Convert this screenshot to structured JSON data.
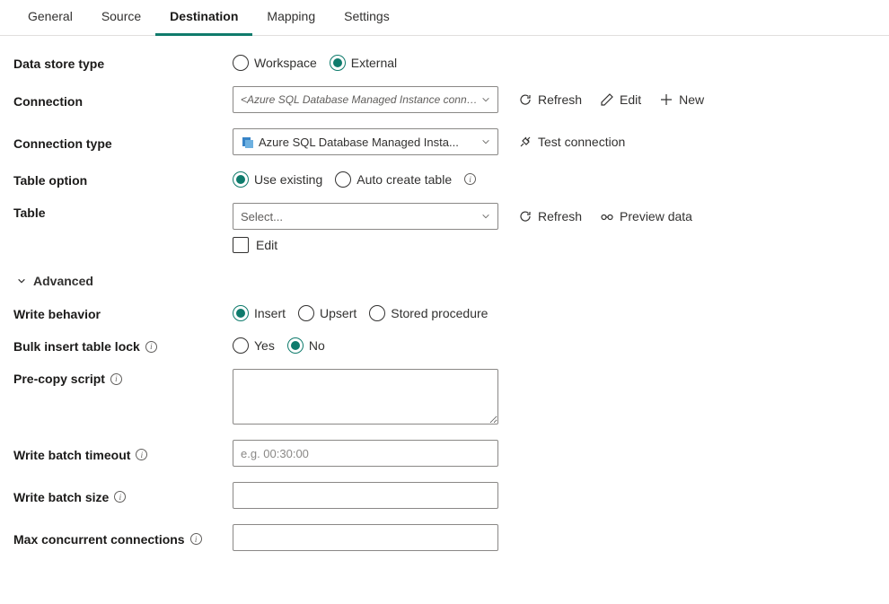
{
  "tabs": {
    "general": "General",
    "source": "Source",
    "destination": "Destination",
    "mapping": "Mapping",
    "settings": "Settings"
  },
  "labels": {
    "data_store_type": "Data store type",
    "connection": "Connection",
    "connection_type": "Connection type",
    "table_option": "Table option",
    "table": "Table",
    "advanced": "Advanced",
    "write_behavior": "Write behavior",
    "bulk_insert_table_lock": "Bulk insert table lock",
    "pre_copy_script": "Pre-copy script",
    "write_batch_timeout": "Write batch timeout",
    "write_batch_size": "Write batch size",
    "max_concurrent_connections": "Max concurrent connections"
  },
  "data_store_type": {
    "workspace": "Workspace",
    "external": "External",
    "selected": "external"
  },
  "connection": {
    "value": "<Azure SQL Database Managed Instance connection>",
    "refresh": "Refresh",
    "edit": "Edit",
    "new": "New"
  },
  "connection_type": {
    "value": "Azure SQL Database Managed Insta...",
    "test": "Test connection"
  },
  "table_option_opts": {
    "use_existing": "Use existing",
    "auto_create": "Auto create table",
    "selected": "use_existing"
  },
  "table": {
    "placeholder": "Select...",
    "refresh": "Refresh",
    "preview": "Preview data",
    "edit": "Edit"
  },
  "write_behavior": {
    "insert": "Insert",
    "upsert": "Upsert",
    "stored_procedure": "Stored procedure",
    "selected": "insert"
  },
  "bulk_lock": {
    "yes": "Yes",
    "no": "No",
    "selected": "no"
  },
  "placeholders": {
    "write_batch_timeout": "e.g. 00:30:00"
  }
}
